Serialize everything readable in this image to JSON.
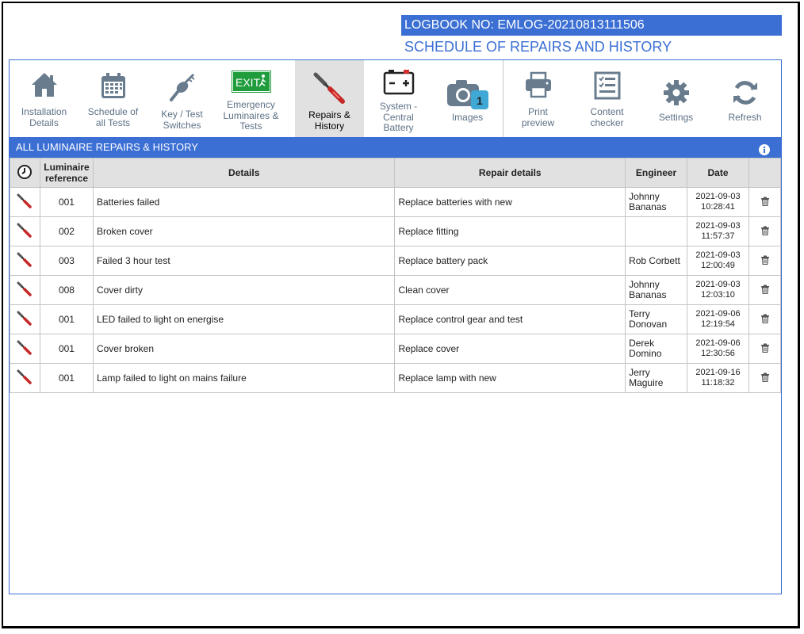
{
  "header": {
    "logbook_no": "LOGBOOK NO: EMLOG-20210813111506",
    "subtitle": "SCHEDULE OF REPAIRS AND HISTORY"
  },
  "toolbar": {
    "items": [
      {
        "line1": "Installation",
        "line2": "Details",
        "line3": "",
        "icon": "home-icon"
      },
      {
        "line1": "Schedule of",
        "line2": "all Tests",
        "line3": "",
        "icon": "calendar-icon"
      },
      {
        "line1": "Key / Test",
        "line2": "Switches",
        "line3": "",
        "icon": "key-switch-icon"
      },
      {
        "line1": "Emergency",
        "line2": "Luminaires &",
        "line3": "Tests",
        "icon": "exit-sign-icon"
      },
      {
        "line1": "Repairs &",
        "line2": "History",
        "line3": "",
        "icon": "screwdriver-icon"
      },
      {
        "line1": "System -",
        "line2": "Central",
        "line3": "Battery",
        "icon": "battery-icon"
      },
      {
        "line1": "Images",
        "line2": "",
        "line3": "",
        "icon": "camera-icon",
        "badge": "1"
      },
      {
        "line1": "Print",
        "line2": "preview",
        "line3": "",
        "icon": "printer-icon"
      },
      {
        "line1": "Content",
        "line2": "checker",
        "line3": "",
        "icon": "checklist-icon"
      },
      {
        "line1": "Settings",
        "line2": "",
        "line3": "",
        "icon": "gear-icon"
      },
      {
        "line1": "Refresh",
        "line2": "",
        "line3": "",
        "icon": "refresh-icon"
      }
    ],
    "exit_text": "EXIT",
    "active": "Repairs & History"
  },
  "section": {
    "title": "ALL LUMINAIRE REPAIRS & HISTORY"
  },
  "table": {
    "headers": {
      "luminaire_line1": "Luminaire",
      "luminaire_line2": "reference",
      "details": "Details",
      "repair": "Repair details",
      "engineer": "Engineer",
      "date": "Date"
    },
    "rows": [
      {
        "ref": "001",
        "details": "Batteries failed",
        "repair": "Replace batteries with new",
        "eng1": "Johnny",
        "eng2": "Bananas",
        "date": "2021-09-03",
        "time": "10:28:41"
      },
      {
        "ref": "002",
        "details": "Broken cover",
        "repair": "Replace fitting",
        "eng1": "",
        "eng2": "",
        "date": "2021-09-03",
        "time": "11:57:37"
      },
      {
        "ref": "003",
        "details": "Failed 3 hour test",
        "repair": "Replace battery pack",
        "eng1": "Rob Corbett",
        "eng2": "",
        "date": "2021-09-03",
        "time": "12:00:49"
      },
      {
        "ref": "008",
        "details": "Cover dirty",
        "repair": "Clean cover",
        "eng1": "Johnny",
        "eng2": "Bananas",
        "date": "2021-09-03",
        "time": "12:03:10"
      },
      {
        "ref": "001",
        "details": "LED failed to light on energise",
        "repair": "Replace control gear and test",
        "eng1": "Terry",
        "eng2": "Donovan",
        "date": "2021-09-06",
        "time": "12:19:54"
      },
      {
        "ref": "001",
        "details": "Cover broken",
        "repair": "Replace cover",
        "eng1": "Derek",
        "eng2": "Domino",
        "date": "2021-09-06",
        "time": "12:30:56"
      },
      {
        "ref": "001",
        "details": "Lamp failed to light on mains failure",
        "repair": "Replace lamp with new",
        "eng1": "Jerry",
        "eng2": "Maguire",
        "date": "2021-09-16",
        "time": "11:18:32"
      }
    ]
  },
  "colors": {
    "accent": "#3b6fd4",
    "icon_grey": "#5d7185",
    "header_bg": "#e1e1e1"
  }
}
